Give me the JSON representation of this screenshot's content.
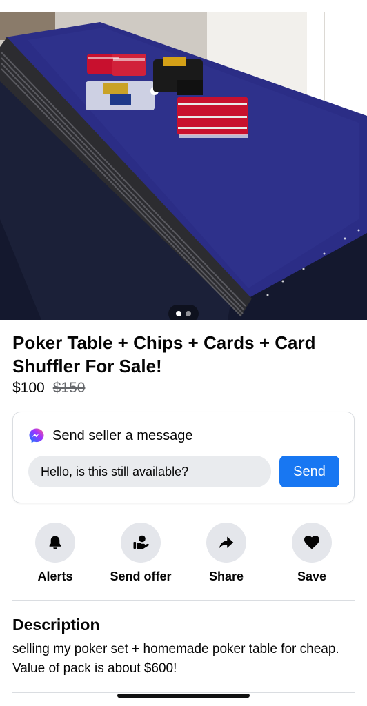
{
  "listing": {
    "title": "Poker Table + Chips + Cards + Card Shuffler For Sale!",
    "price": "$100",
    "original_price": "$150",
    "photo_count": 2,
    "active_photo_index": 0
  },
  "message": {
    "title": "Send seller a message",
    "input_value": "Hello, is this still available?",
    "send_label": "Send"
  },
  "actions": [
    {
      "label": "Alerts",
      "icon": "bell-icon"
    },
    {
      "label": "Send offer",
      "icon": "send-offer-icon"
    },
    {
      "label": "Share",
      "icon": "share-arrow-icon"
    },
    {
      "label": "Save",
      "icon": "heart-icon"
    }
  ],
  "description": {
    "heading": "Description",
    "body": "selling my poker set + homemade poker table for cheap. Value of pack is about $600!"
  },
  "colors": {
    "accent": "#1877f2",
    "felt": "#2b2d86",
    "chip_red": "#c8102e"
  }
}
